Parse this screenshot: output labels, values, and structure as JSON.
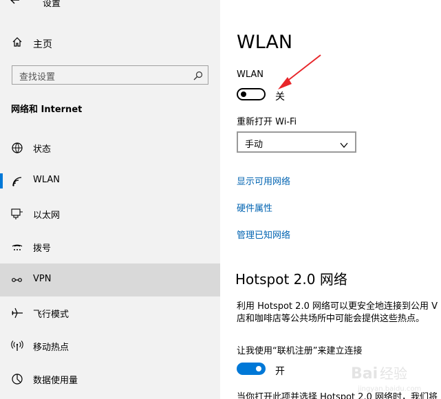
{
  "header": {
    "back_icon": "back-arrow-icon",
    "title": "设置"
  },
  "sidebar": {
    "home_label": "主页",
    "search_placeholder": "查找设置",
    "section_title": "网络和 Internet",
    "items": [
      {
        "label": "状态",
        "icon": "globe-icon"
      },
      {
        "label": "WLAN",
        "icon": "wifi-icon",
        "active": true
      },
      {
        "label": "以太网",
        "icon": "ethernet-icon"
      },
      {
        "label": "拨号",
        "icon": "dial-up-icon"
      },
      {
        "label": "VPN",
        "icon": "vpn-icon",
        "hovered": true
      },
      {
        "label": "飞行模式",
        "icon": "airplane-icon"
      },
      {
        "label": "移动热点",
        "icon": "hotspot-icon"
      },
      {
        "label": "数据使用量",
        "icon": "data-usage-icon"
      }
    ]
  },
  "main": {
    "title": "WLAN",
    "wlan_label": "WLAN",
    "wlan_toggle_state": "关",
    "wlan_on": false,
    "reopen_label": "重新打开 Wi-Fi",
    "reopen_value": "手动",
    "links": [
      "显示可用网络",
      "硬件属性",
      "管理已知网络"
    ],
    "hotspot_title": "Hotspot 2.0 网络",
    "hotspot_desc_line1": "利用 Hotspot 2.0 网络可以更安全地连接到公用 V",
    "hotspot_desc_line2": "店和咖啡店等公共场所中可能会提供这些热点。",
    "online_reg_label": "让我使用“联机注册”来建立连接",
    "online_reg_state": "开",
    "online_reg_on": true,
    "bottom_text": "当你打开此项并选择 Hotspot 2.0 网络时，我们将"
  },
  "colors": {
    "accent": "#0078d7",
    "link": "#0063b1",
    "annotation": "#e8262a"
  }
}
